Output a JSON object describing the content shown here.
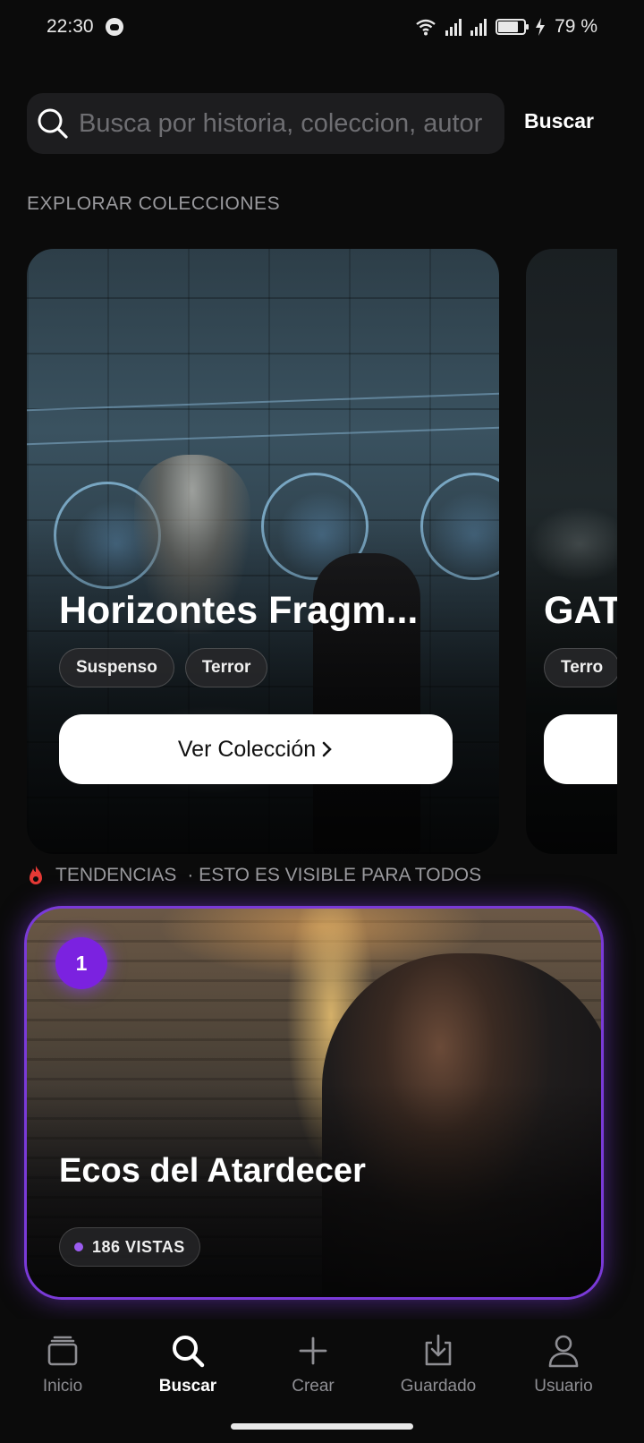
{
  "status_bar": {
    "time": "22:30",
    "battery_text": "79 %",
    "icons": [
      "app-notification-icon",
      "wifi-icon",
      "signal-icon",
      "signal-icon",
      "battery-icon",
      "charging-icon"
    ]
  },
  "search": {
    "placeholder": "Busca por historia, coleccion, autor",
    "button_label": "Buscar"
  },
  "collections_section": {
    "label": "EXPLORAR COLECCIONES",
    "cards": [
      {
        "title": "Horizontes Fragm...",
        "tags": [
          "Suspenso",
          "Terror"
        ],
        "cta": "Ver Colección"
      },
      {
        "title": "GAT",
        "tags": [
          "Terro"
        ],
        "cta": ""
      }
    ]
  },
  "trending": {
    "label": "TENDENCIAS",
    "visibility_note": "· ESTO ES VISIBLE PARA TODOS",
    "card": {
      "rank": "1",
      "title": "Ecos del Atardecer",
      "views": "186 VISTAS"
    },
    "accent_color": "#7b22e0"
  },
  "bottom_nav": {
    "items": [
      {
        "label": "Inicio",
        "icon": "stack-icon"
      },
      {
        "label": "Buscar",
        "icon": "search-icon",
        "active": true
      },
      {
        "label": "Crear",
        "icon": "plus-icon"
      },
      {
        "label": "Guardado",
        "icon": "download-icon"
      },
      {
        "label": "Usuario",
        "icon": "user-icon"
      }
    ]
  }
}
